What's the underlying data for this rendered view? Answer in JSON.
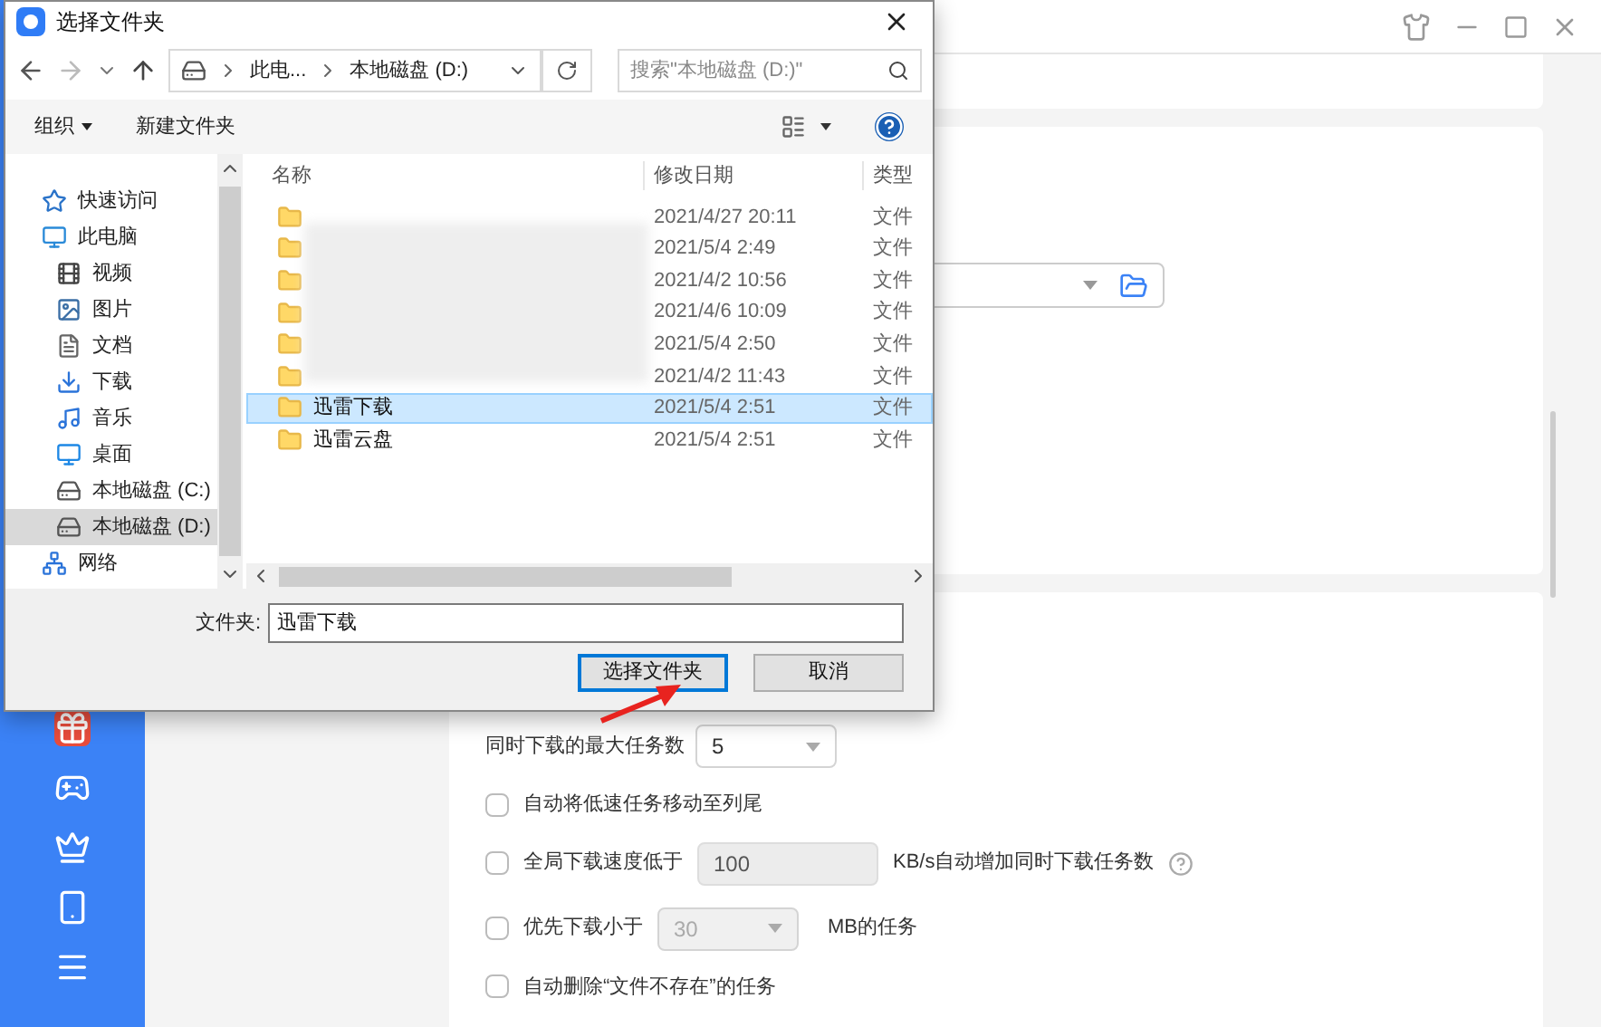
{
  "dialog": {
    "title": "选择文件夹",
    "address": [
      "此电...",
      "本地磁盘 (D:)"
    ],
    "search": {
      "placeholder": "搜索\"本地磁盘 (D:)\""
    },
    "toolbar": [
      "组织",
      "新建文件夹"
    ],
    "nav": [
      {
        "label": "快速访问",
        "selected": false
      },
      {
        "label": "此电脑",
        "selected": false,
        "children": [
          {
            "label": "视频",
            "selected": false
          },
          {
            "label": "图片",
            "selected": false
          },
          {
            "label": "文档",
            "selected": false
          },
          {
            "label": "下载",
            "selected": false
          },
          {
            "label": "音乐",
            "selected": false
          },
          {
            "label": "桌面",
            "selected": false
          },
          {
            "label": "本地磁盘 (C:)",
            "selected": false
          },
          {
            "label": "本地磁盘 (D:)",
            "selected": true
          }
        ]
      },
      {
        "label": "网络",
        "selected": false
      }
    ],
    "columns": [
      "名称",
      "修改日期",
      "类型"
    ],
    "rows": [
      {
        "date": "2021/4/27 20:11",
        "type": "文件",
        "selected": false
      },
      {
        "date": "2021/5/4 2:49",
        "type": "文件",
        "selected": false
      },
      {
        "date": "2021/4/2 10:56",
        "type": "文件",
        "selected": false
      },
      {
        "date": "2021/4/6 10:09",
        "type": "文件",
        "selected": false
      },
      {
        "date": "2021/5/4 2:50",
        "type": "文件",
        "selected": false
      },
      {
        "date": "2021/4/2 11:43",
        "type": "文件",
        "selected": false
      },
      {
        "name": "迅雷下载",
        "date": "2021/5/4 2:51",
        "type": "文件",
        "selected": true
      },
      {
        "name": "迅雷云盘",
        "date": "2021/5/4 2:51",
        "type": "文件",
        "selected": false
      }
    ],
    "folder_label": "文件夹:",
    "folder_value": "迅雷下载",
    "buttons": [
      {
        "label": "选择文件夹",
        "primary": true
      },
      {
        "label": "取消",
        "primary": false
      }
    ]
  },
  "settings": [
    {
      "kind": "select",
      "label": "同时下载的最大任务数",
      "value": "5",
      "disabled": false
    },
    {
      "kind": "checkbox",
      "label": "自动将低速任务移动至列尾",
      "checked": false
    },
    {
      "kind": "input",
      "label": "全局下载速度低于",
      "value": "100",
      "suffix": "KB/s自动增加同时下载任务数",
      "checked": false,
      "help": true
    },
    {
      "kind": "checkbox_select",
      "label": "优先下载小于",
      "value": "30",
      "suffix": "MB的任务",
      "checked": false
    },
    {
      "kind": "checkbox",
      "label": "自动删除“文件不存在”的任务",
      "checked": false
    }
  ]
}
